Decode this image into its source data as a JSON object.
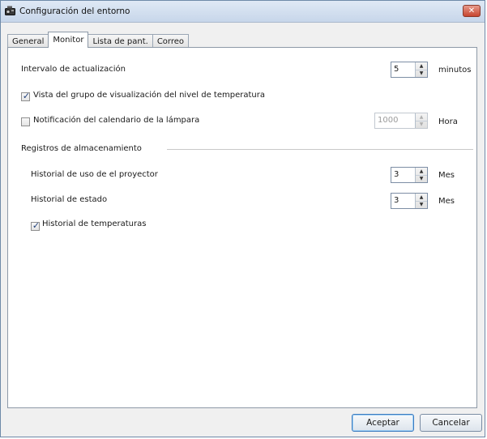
{
  "window": {
    "title": "Configuración del entorno",
    "close_symbol": "✕"
  },
  "tabs": [
    {
      "label": "General",
      "active": false
    },
    {
      "label": "Monitor",
      "active": true
    },
    {
      "label": "Lista de pant.",
      "active": false
    },
    {
      "label": "Correo",
      "active": false
    }
  ],
  "monitor": {
    "update_interval": {
      "label": "Intervalo de actualización",
      "value": "5",
      "unit": "minutos"
    },
    "temperature_view": {
      "label": "Vista del grupo de visualización del nivel de temperatura",
      "checked": true
    },
    "lamp_notification": {
      "label": "Notificación del calendario de la lámpara",
      "checked": false,
      "value": "1000",
      "unit": "Hora",
      "enabled": false
    },
    "storage_group": {
      "label": "Registros de almacenamiento",
      "usage_history": {
        "label": "Historial de uso de el proyector",
        "value": "3",
        "unit": "Mes"
      },
      "status_history": {
        "label": "Historial de estado",
        "value": "3",
        "unit": "Mes"
      },
      "temperature_history": {
        "label": "Historial de temperaturas",
        "checked": true
      }
    }
  },
  "buttons": {
    "ok": "Aceptar",
    "cancel": "Cancelar"
  },
  "icons": {
    "check": "✓",
    "spin_up": "▲",
    "spin_down": "▼"
  },
  "colors": {
    "titlebar": "#c7d6ea",
    "close": "#c7452f",
    "check_mark": "#1f3f7a"
  }
}
